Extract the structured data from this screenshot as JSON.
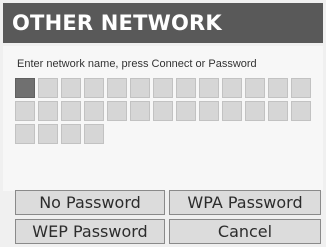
{
  "title": "OTHER NETWORK",
  "instruction": "Enter network name, press Connect or Password",
  "name_entry": {
    "cell_count": 30,
    "cursor_index": 0
  },
  "buttons": {
    "no_password": "No Password",
    "wpa_password": "WPA Password",
    "wep_password": "WEP Password",
    "cancel": "Cancel"
  }
}
